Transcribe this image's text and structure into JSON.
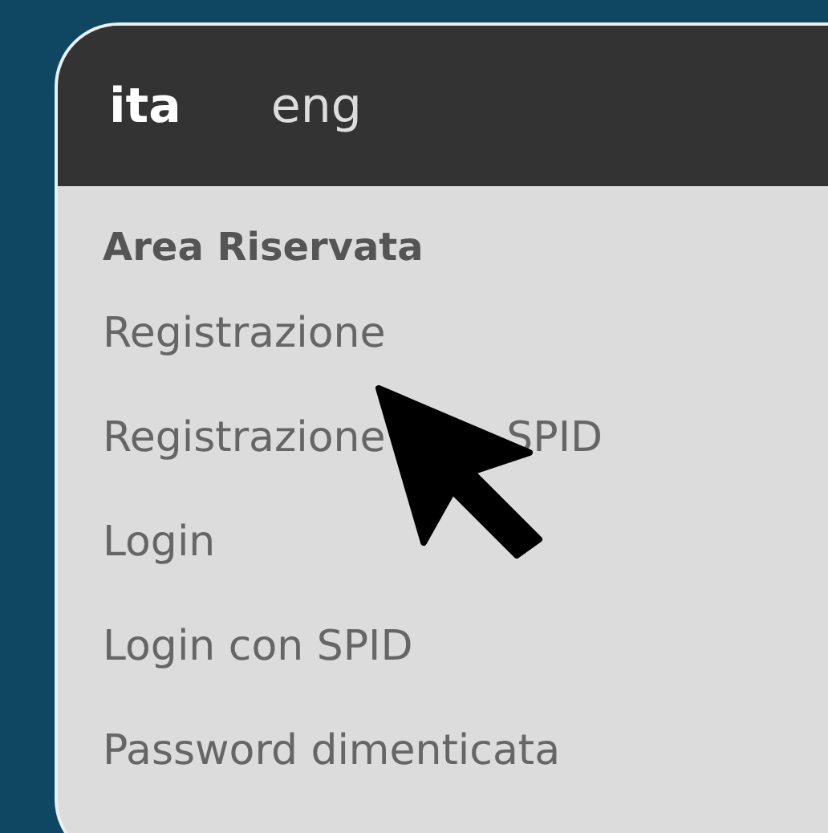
{
  "languages": [
    {
      "label": "ita",
      "selected": true
    },
    {
      "label": "eng",
      "selected": false
    }
  ],
  "section_title": "Area Riservata",
  "menu_items": [
    {
      "text_parts": [
        "Registrazione"
      ]
    },
    {
      "text_parts": [
        "Registrazione",
        "SPID"
      ]
    },
    {
      "text_parts": [
        "Login"
      ]
    },
    {
      "text_parts": [
        "Login con SPID"
      ]
    },
    {
      "text_parts": [
        "Password dimenticata"
      ]
    }
  ]
}
